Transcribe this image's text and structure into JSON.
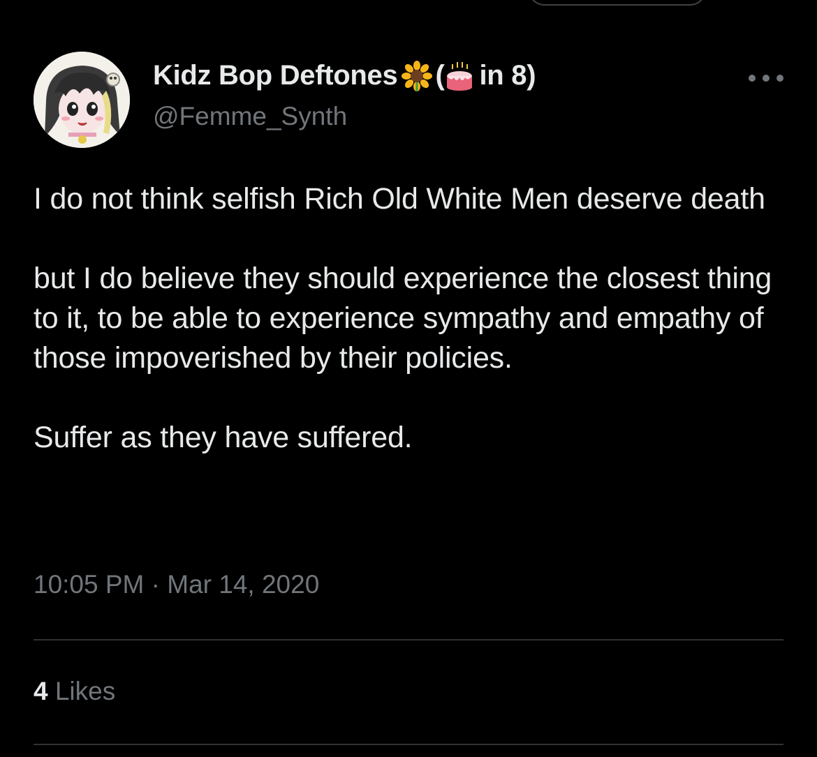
{
  "author": {
    "name": "Kidz Bop Deftones",
    "name_suffix": "in 8)",
    "name_paren_open": "(",
    "emoji_1": "sunflower-emoji",
    "emoji_2": "birthday-cake-emoji",
    "handle": "@Femme_Synth"
  },
  "tweet": {
    "paragraphs": [
      "I do not think selfish Rich Old White Men deserve death",
      "but I do believe they should experience the closest thing to it, to be able to experience sympathy and empathy of those impoverished by their policies.",
      "Suffer as they have suffered."
    ],
    "time": "10:05 PM",
    "separator": " · ",
    "date": "Mar 14, 2020"
  },
  "stats": {
    "likes_count": "4",
    "likes_label": "Likes"
  },
  "colors": {
    "background": "#000000",
    "text_primary": "#e7e9ea",
    "text_secondary": "#71767b",
    "divider": "#2f3336"
  }
}
